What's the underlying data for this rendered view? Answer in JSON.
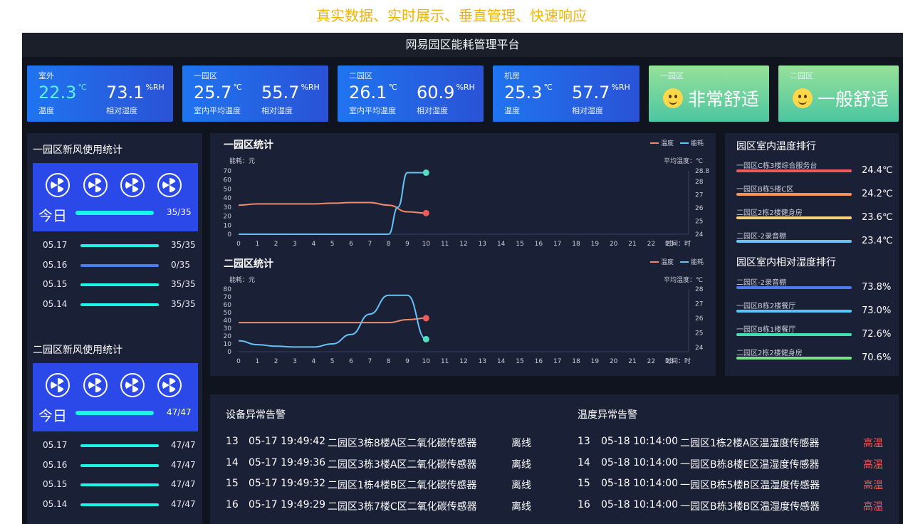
{
  "caption": "真实数据、实时展示、垂直管理、快速响应",
  "app_title": "网易园区能耗管理平台",
  "colors": {
    "accent_blue": "#2a49e8",
    "cyan": "#1af5e8",
    "temp_line": "#ef8a6a",
    "energy_line": "#52e0c4",
    "alert_red": "#ef5a5a"
  },
  "cards": [
    {
      "label": "室外",
      "v1": "22.3",
      "u1": "℃",
      "s1": "温度",
      "v2": "73.1",
      "u2": "%RH",
      "s2": "相对湿度"
    },
    {
      "label": "一园区",
      "v1": "25.7",
      "u1": "℃",
      "s1": "室内平均温度",
      "v2": "55.7",
      "u2": "%RH",
      "s2": "相对湿度"
    },
    {
      "label": "二园区",
      "v1": "26.1",
      "u1": "℃",
      "s1": "室内平均温度",
      "v2": "60.9",
      "u2": "%RH",
      "s2": "相对湿度"
    },
    {
      "label": "机房",
      "v1": "25.3",
      "u1": "℃",
      "s1": "温度",
      "v2": "57.7",
      "u2": "%RH",
      "s2": "相对湿度"
    }
  ],
  "comfort": [
    {
      "label": "一园区",
      "text": "非常舒适",
      "icon": "smiley-icon"
    },
    {
      "label": "二园区",
      "text": "一般舒适",
      "icon": "smiley-icon"
    }
  ],
  "fresh_air": [
    {
      "title": "一园区新风使用统计",
      "today_label": "今日",
      "today_value": "35/35",
      "rows": [
        {
          "date": "05.17",
          "value": "35/35",
          "fraction": 1.0
        },
        {
          "date": "05.16",
          "value": "0/35",
          "fraction": 0.0
        },
        {
          "date": "05.15",
          "value": "35/35",
          "fraction": 1.0
        },
        {
          "date": "05.14",
          "value": "35/35",
          "fraction": 1.0
        }
      ]
    },
    {
      "title": "二园区新风使用统计",
      "today_label": "今日",
      "today_value": "47/47",
      "rows": [
        {
          "date": "05.17",
          "value": "47/47",
          "fraction": 1.0
        },
        {
          "date": "05.16",
          "value": "47/47",
          "fraction": 1.0
        },
        {
          "date": "05.15",
          "value": "47/47",
          "fraction": 1.0
        },
        {
          "date": "05.14",
          "value": "47/47",
          "fraction": 1.0
        }
      ]
    }
  ],
  "chart_data": [
    {
      "type": "line",
      "title": "一园区统计",
      "legend": [
        "温度",
        "能耗"
      ],
      "legend_position": "top-right",
      "ylabel_left": "能耗：元",
      "ylabel_right": "平均温度：℃",
      "xlabel": "时间：时",
      "x": [
        0,
        1,
        2,
        3,
        4,
        5,
        6,
        7,
        8,
        9,
        10,
        11,
        12,
        13,
        14,
        15,
        16,
        17,
        18,
        19,
        20,
        21,
        22,
        23
      ],
      "ylim_left": [
        0,
        70
      ],
      "yticks_left": [
        0,
        10,
        20,
        30,
        40,
        50,
        60,
        70
      ],
      "ylim_right": [
        24,
        28.8
      ],
      "yticks_right": [
        "24",
        "25",
        "26",
        "27",
        "28",
        "28.8"
      ],
      "series": [
        {
          "name": "温度",
          "axis": "right",
          "x": [
            0,
            1,
            2,
            3,
            4,
            5,
            6,
            7,
            8,
            9,
            10
          ],
          "values": [
            26.2,
            26.3,
            26.3,
            26.3,
            26.3,
            26.35,
            26.4,
            26.4,
            26.2,
            25.7,
            25.6
          ]
        },
        {
          "name": "能耗",
          "axis": "left",
          "x": [
            0,
            1,
            2,
            3,
            4,
            5,
            6,
            7,
            8,
            8.5,
            9,
            10
          ],
          "values": [
            0,
            0,
            0,
            0,
            0,
            0,
            0,
            0,
            0,
            30,
            68,
            68
          ]
        }
      ]
    },
    {
      "type": "line",
      "title": "二园区统计",
      "legend": [
        "温度",
        "能耗"
      ],
      "legend_position": "top-right",
      "ylabel_left": "能耗：元",
      "ylabel_right": "平均温度：℃",
      "xlabel": "时间：时",
      "x": [
        0,
        1,
        2,
        3,
        4,
        5,
        6,
        7,
        8,
        9,
        10,
        11,
        12,
        13,
        14,
        15,
        16,
        17,
        18,
        19,
        20,
        21,
        22,
        23
      ],
      "ylim_left": [
        0,
        80
      ],
      "yticks_left": [
        0,
        10,
        20,
        30,
        40,
        50,
        60,
        70,
        80
      ],
      "ylim_right": [
        23.7,
        28
      ],
      "yticks_right": [
        "24",
        "25",
        "26",
        "27",
        "28"
      ],
      "series": [
        {
          "name": "温度",
          "axis": "right",
          "x": [
            0,
            1,
            2,
            3,
            4,
            5,
            6,
            7,
            8,
            9,
            10
          ],
          "values": [
            25.7,
            25.7,
            25.7,
            25.7,
            25.7,
            25.7,
            25.7,
            25.7,
            25.7,
            25.9,
            26.0
          ]
        },
        {
          "name": "能耗",
          "axis": "left",
          "x": [
            0,
            1,
            2,
            3,
            4,
            5,
            6,
            7,
            8,
            9,
            10
          ],
          "values": [
            14,
            9,
            7,
            6,
            6,
            10,
            22,
            48,
            72,
            72,
            16
          ]
        }
      ]
    }
  ],
  "temp_rank": {
    "title": "园区室内温度排行",
    "items": [
      {
        "name": "一园区C栋3楼综合服务台",
        "value": "24.4℃",
        "color": "#ef5a5a"
      },
      {
        "name": "一园区B栋5楼C区",
        "value": "24.2℃",
        "color": "#f2935a"
      },
      {
        "name": "二园区2栋2楼健身房",
        "value": "23.6℃",
        "color": "#f7d27a"
      },
      {
        "name": "二园区-2录音棚",
        "value": "23.4℃",
        "color": "#67c2f5"
      }
    ]
  },
  "humidity_rank": {
    "title": "园区室内相对湿度排行",
    "items": [
      {
        "name": "二园区-2录音棚",
        "value": "73.8%",
        "color": "#4a7cf0"
      },
      {
        "name": "一园区B栋2楼餐厅",
        "value": "73.0%",
        "color": "#56c7f5"
      },
      {
        "name": "一园区B栋1楼餐厅",
        "value": "72.6%",
        "color": "#3ee0b0"
      },
      {
        "name": "二园区2栋2楼健身房",
        "value": "70.6%",
        "color": "#7ce08a"
      }
    ]
  },
  "device_alerts": {
    "title": "设备异常告警",
    "rows": [
      {
        "no": "13",
        "time": "05-17 19:49:42",
        "device": "二园区3栋8楼A区二氧化碳传感器",
        "status": "离线"
      },
      {
        "no": "14",
        "time": "05-17 19:49:36",
        "device": "二园区3栋3楼A区二氧化碳传感器",
        "status": "离线"
      },
      {
        "no": "15",
        "time": "05-17 19:49:32",
        "device": "二园区1栋4楼B区二氧化碳传感器",
        "status": "离线"
      },
      {
        "no": "16",
        "time": "05-17 19:49:29",
        "device": "二园区3栋7楼C区二氧化碳传感器",
        "status": "离线"
      }
    ]
  },
  "temp_alerts": {
    "title": "温度异常告警",
    "rows": [
      {
        "no": "13",
        "time": "05-18 10:14:00",
        "device": "二园区1栋2楼A区温湿度传感器",
        "status": "高温"
      },
      {
        "no": "14",
        "time": "05-18 10:14:00",
        "device": "一园区B栋8楼E区温湿度传感器",
        "status": "高温"
      },
      {
        "no": "15",
        "time": "05-18 10:14:00",
        "device": "一园区B栋5楼B区温湿度传感器",
        "status": "高温"
      },
      {
        "no": "16",
        "time": "05-18 10:14:00",
        "device": "一园区B栋3楼B区温湿度传感器",
        "status": "高温"
      }
    ]
  }
}
